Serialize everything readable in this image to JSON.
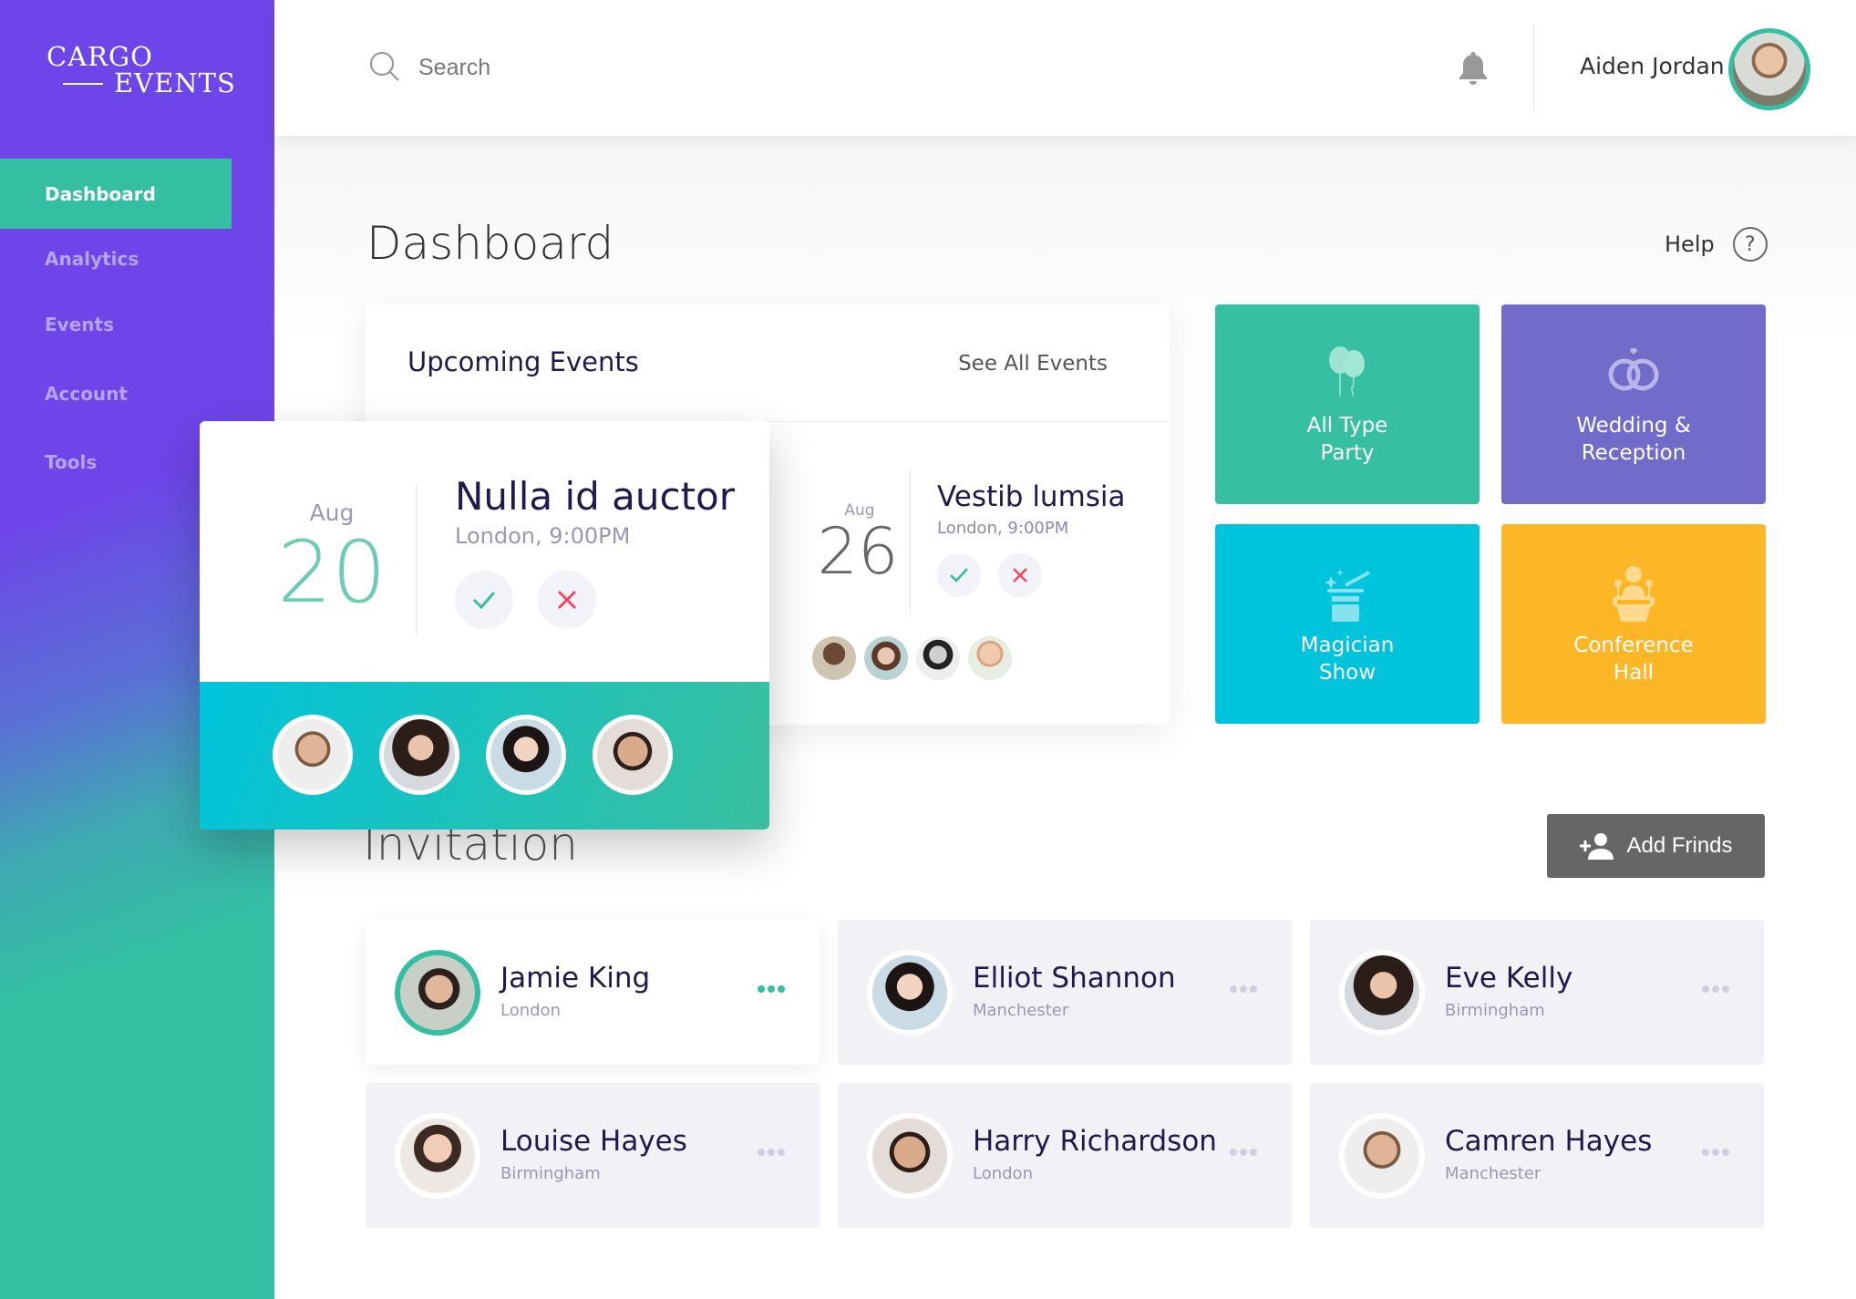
{
  "brand": {
    "line1": "CARGO",
    "line2": "EVENTS"
  },
  "sidebar": {
    "items": [
      {
        "label": "Dashboard",
        "active": true
      },
      {
        "label": "Analytics",
        "active": false
      },
      {
        "label": "Events",
        "active": false
      },
      {
        "label": "Account",
        "active": false
      },
      {
        "label": "Tools",
        "active": false
      }
    ]
  },
  "header": {
    "search_placeholder": "Search",
    "user_name": "Aiden Jordan",
    "icons": {
      "search": "search-icon",
      "notifications": "bell-icon"
    }
  },
  "main": {
    "title": "Dashboard",
    "help_label": "Help",
    "help_icon": "?"
  },
  "upcoming": {
    "title": "Upcoming Events",
    "see_all": "See All Events",
    "events": [
      {
        "month": "Aug",
        "day": "20",
        "title": "Nulla id auctor",
        "location": "London, 9:00PM",
        "attendees": 4,
        "highlighted": true
      },
      {
        "month": "Aug",
        "day": "26",
        "title": "Vestib lumsia",
        "location": "London, 9:00PM",
        "attendees": 4,
        "highlighted": false
      }
    ]
  },
  "categories": [
    {
      "line1": "All Type",
      "line2": "Party",
      "icon": "balloons-icon",
      "color": "#37bfa2"
    },
    {
      "line1": "Wedding &",
      "line2": "Reception",
      "icon": "wedding-rings-icon",
      "color": "#726bc9"
    },
    {
      "line1": "Magician",
      "line2": "Show",
      "icon": "magic-hat-icon",
      "color": "#00c4dc"
    },
    {
      "line1": "Conference",
      "line2": "Hall",
      "icon": "speaker-podium-icon",
      "color": "#fdb726"
    }
  ],
  "invitation": {
    "title": "Invitation",
    "add_button": "Add Frinds",
    "people": [
      {
        "name": "Jamie King",
        "city": "London",
        "active": true
      },
      {
        "name": "Elliot Shannon",
        "city": "Manchester",
        "active": false
      },
      {
        "name": "Eve Kelly",
        "city": "Birmingham",
        "active": false
      },
      {
        "name": "Louise Hayes",
        "city": "Birmingham",
        "active": false
      },
      {
        "name": "Harry Richardson",
        "city": "London",
        "active": false
      },
      {
        "name": "Camren Hayes",
        "city": "Manchester",
        "active": false
      }
    ]
  },
  "colors": {
    "primary": "#6e45e8",
    "accent": "#34bfa3",
    "decline": "#f0445f",
    "text_dark": "#1e1a4d"
  }
}
